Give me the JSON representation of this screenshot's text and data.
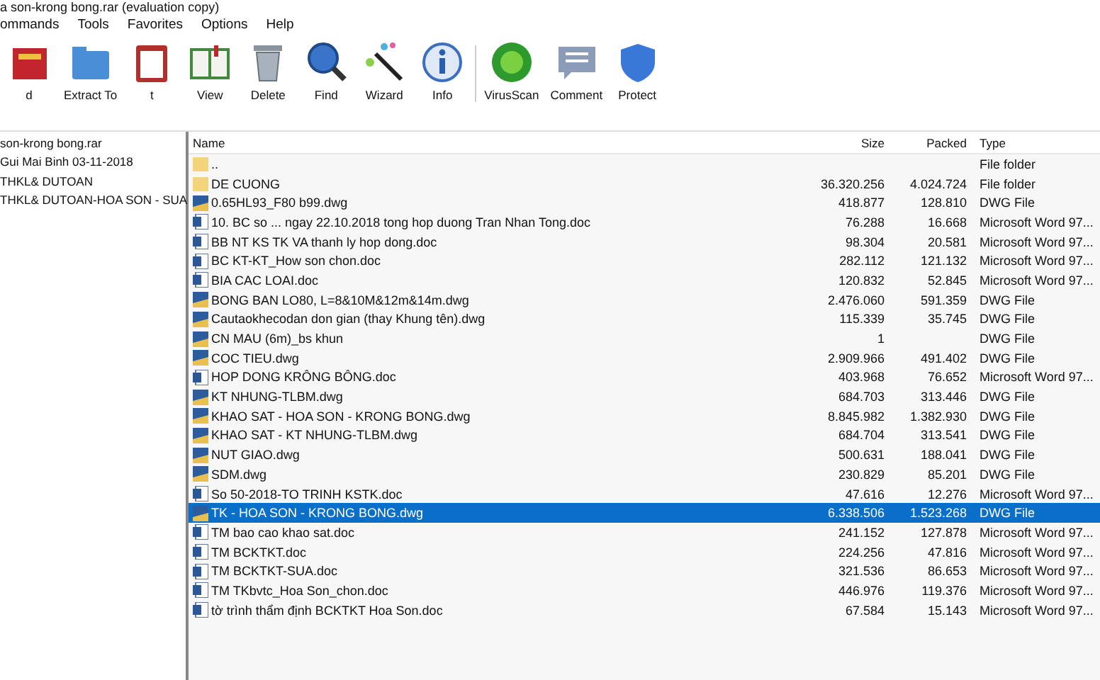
{
  "window": {
    "title": "a son-krong bong.rar (evaluation copy)"
  },
  "menu": [
    "ommands",
    "Tools",
    "Favorites",
    "Options",
    "Help"
  ],
  "toolbar": [
    {
      "label": "d",
      "kind": "add"
    },
    {
      "label": "Extract To",
      "kind": "extract"
    },
    {
      "label": "t",
      "kind": "test"
    },
    {
      "label": "View",
      "kind": "view"
    },
    {
      "label": "Delete",
      "kind": "delete"
    },
    {
      "label": "Find",
      "kind": "find"
    },
    {
      "label": "Wizard",
      "kind": "wizard"
    },
    {
      "label": "Info",
      "kind": "info"
    },
    {
      "label": "VirusScan",
      "kind": "virus"
    },
    {
      "label": "Comment",
      "kind": "comment"
    },
    {
      "label": "Protect",
      "kind": "protect"
    }
  ],
  "tree": [
    {
      "label": "son-krong bong.rar",
      "selected": false
    },
    {
      "label": "Gui Mai Binh 03-11-2018",
      "selected": false
    },
    {
      "label": "THKL& DUTOAN",
      "selected": false
    },
    {
      "label": "THKL& DUTOAN-HOA SON - SUA",
      "selected": false
    }
  ],
  "table": {
    "columns": [
      "Name",
      "Size",
      "Packed",
      "Type"
    ],
    "rows": [
      {
        "kind": "folder",
        "name": "..",
        "type": "File folder",
        "selected": false
      },
      {
        "kind": "folder",
        "name": "DE CUONG",
        "size": "36.320.256",
        "packed": "4.024.724",
        "type": "File folder",
        "selected": false
      },
      {
        "kind": "dwg",
        "name": "0.65HL93_F80 b99.dwg",
        "size": "418.877",
        "packed": "128.810",
        "type": "DWG File",
        "selected": false
      },
      {
        "kind": "doc",
        "name": "10. BC so ... ngay 22.10.2018 tong hop duong Tran Nhan Tong.doc",
        "size": "76.288",
        "packed": "16.668",
        "type": "Microsoft Word 97...",
        "selected": false
      },
      {
        "kind": "doc",
        "name": "BB NT KS TK VA thanh ly hop dong.doc",
        "size": "98.304",
        "packed": "20.581",
        "type": "Microsoft Word 97...",
        "selected": false
      },
      {
        "kind": "doc",
        "name": "BC KT-KT_How son chon.doc",
        "size": "282.112",
        "packed": "121.132",
        "type": "Microsoft Word 97...",
        "selected": false
      },
      {
        "kind": "doc",
        "name": "BIA CAC LOAI.doc",
        "size": "120.832",
        "packed": "52.845",
        "type": "Microsoft Word 97...",
        "selected": false
      },
      {
        "kind": "dwg",
        "name": "BONG BAN LO80, L=8&10M&12m&14m.dwg",
        "size": "2.476.060",
        "packed": "591.359",
        "type": "DWG File",
        "selected": false
      },
      {
        "kind": "dwg",
        "name": "Cautaokhecodan don gian (thay Khung tên).dwg",
        "size": "115.339",
        "packed": "35.745",
        "type": "DWG File",
        "selected": false
      },
      {
        "kind": "dwg",
        "name": "CN MAU (6m)_bs khun",
        "size": "1",
        "type": "DWG File",
        "selected": false
      },
      {
        "kind": "dwg",
        "name": "COC TIEU.dwg",
        "size": "2.909.966",
        "packed": "491.402",
        "type": "DWG File",
        "selected": false
      },
      {
        "kind": "doc",
        "name": "HOP DONG KRÔNG BÔNG.doc",
        "size": "403.968",
        "packed": "76.652",
        "type": "Microsoft Word 97...",
        "selected": false
      },
      {
        "kind": "dwg",
        "name": "KT NHUNG-TLBM.dwg",
        "size": "684.703",
        "packed": "313.446",
        "type": "DWG File",
        "selected": false
      },
      {
        "kind": "dwg",
        "name": "KHAO SAT - HOA SON - KRONG BONG.dwg",
        "size": "8.845.982",
        "packed": "1.382.930",
        "type": "DWG File",
        "selected": false
      },
      {
        "kind": "dwg",
        "name": "KHAO SAT - KT NHUNG-TLBM.dwg",
        "size": "684.704",
        "packed": "313.541",
        "type": "DWG File",
        "selected": false
      },
      {
        "kind": "dwg",
        "name": "NUT GIAO.dwg",
        "size": "500.631",
        "packed": "188.041",
        "type": "DWG File",
        "selected": false
      },
      {
        "kind": "dwg",
        "name": "SDM.dwg",
        "size": "230.829",
        "packed": "85.201",
        "type": "DWG File",
        "selected": false
      },
      {
        "kind": "doc",
        "name": "So 50-2018-TO TRINH KSTK.doc",
        "size": "47.616",
        "packed": "12.276",
        "type": "Microsoft Word 97...",
        "selected": false
      },
      {
        "kind": "dwg",
        "name": "TK - HOA SON - KRONG BONG.dwg",
        "size": "6.338.506",
        "packed": "1.523.268",
        "type": "DWG File",
        "selected": true
      },
      {
        "kind": "doc",
        "name": "TM bao cao khao sat.doc",
        "size": "241.152",
        "packed": "127.878",
        "type": "Microsoft Word 97...",
        "selected": false
      },
      {
        "kind": "doc",
        "name": "TM BCKTKT.doc",
        "size": "224.256",
        "packed": "47.816",
        "type": "Microsoft Word 97...",
        "selected": false
      },
      {
        "kind": "doc",
        "name": "TM BCKTKT-SUA.doc",
        "size": "321.536",
        "packed": "86.653",
        "type": "Microsoft Word 97...",
        "selected": false
      },
      {
        "kind": "doc",
        "name": "TM TKbvtc_Hoa Son_chon.doc",
        "size": "446.976",
        "packed": "119.376",
        "type": "Microsoft Word 97...",
        "selected": false
      },
      {
        "kind": "doc",
        "name": "tờ trình thẩm định BCKTKT Hoa Son.doc",
        "size": "67.584",
        "packed": "15.143",
        "type": "Microsoft Word 97...",
        "selected": false
      }
    ]
  }
}
